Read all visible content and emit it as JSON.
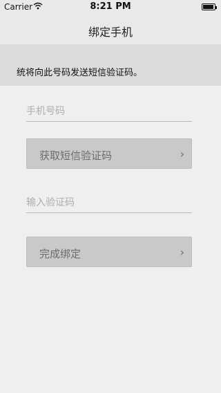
{
  "status_bar": {
    "carrier": "Carrier",
    "time": "8:21 PM",
    "battery_level": 0.95
  },
  "nav": {
    "title": "绑定手机"
  },
  "notice": {
    "text": "统将向此号码发送短信验证码。"
  },
  "form": {
    "phone_placeholder": "手机号码",
    "code_placeholder": "输入验证码",
    "get_code_label": "获取短信验证码",
    "bind_label": "完成绑定",
    "chevron": "›"
  }
}
